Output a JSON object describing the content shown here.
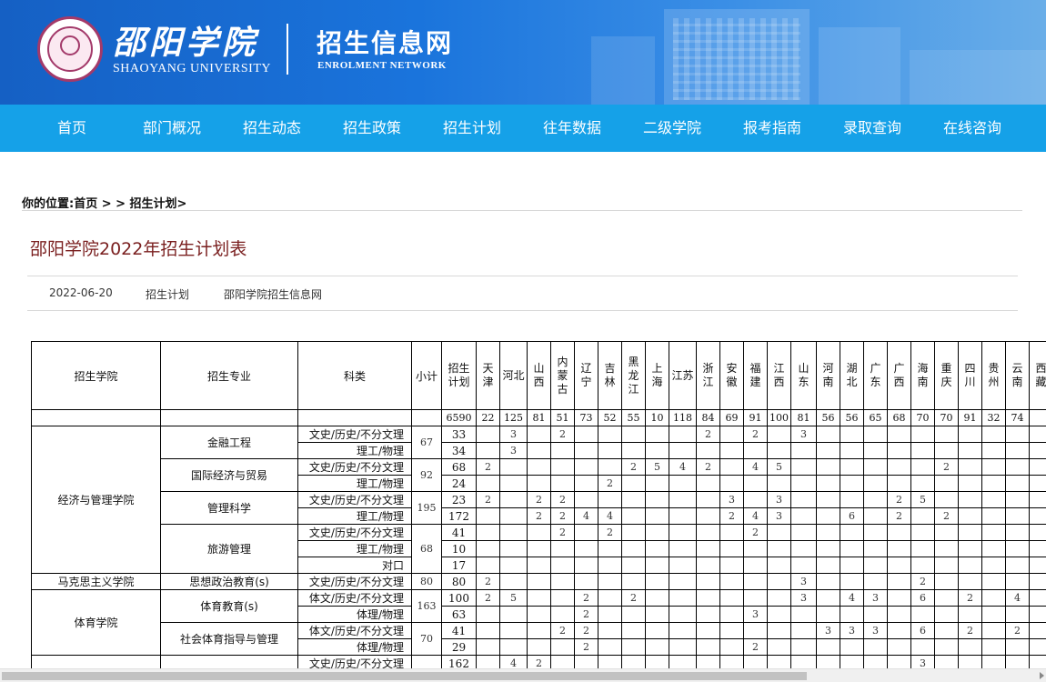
{
  "header": {
    "cn_name": "邵阳学院",
    "en_name": "SHAOYANG UNIVERSITY",
    "site_name": "招生信息网",
    "site_en": "ENROLMENT NETWORK"
  },
  "nav": [
    "首页",
    "部门概况",
    "招生动态",
    "招生政策",
    "招生计划",
    "往年数据",
    "二级学院",
    "报考指南",
    "录取查询",
    "在线咨询"
  ],
  "breadcrumb": "你的位置:首页 > > 招生计划>",
  "article": {
    "title": "邵阳学院2022年招生计划表",
    "date": "2022-06-20",
    "category": "招生计划",
    "source": "邵阳学院招生信息网"
  },
  "table": {
    "headers": {
      "college": "招生学院",
      "major": "招生专业",
      "type": "科类",
      "subtotal": "小计",
      "plan": "招生计划"
    },
    "provinces": [
      "天津",
      "河北",
      "山西",
      "内蒙古",
      "辽宁",
      "吉林",
      "黑龙江",
      "上海",
      "江苏",
      "浙江",
      "安徽",
      "福建",
      "江西",
      "山东",
      "河南",
      "湖北",
      "广东",
      "广西",
      "海南",
      "重庆",
      "四川",
      "贵州",
      "云南",
      "西藏"
    ],
    "totals": {
      "plan": "6590",
      "values": [
        "22",
        "125",
        "81",
        "51",
        "73",
        "52",
        "55",
        "10",
        "118",
        "84",
        "69",
        "91",
        "100",
        "81",
        "56",
        "56",
        "65",
        "68",
        "70",
        "70",
        "91",
        "32",
        "74",
        ""
      ]
    },
    "colleges": [
      {
        "name": "经济与管理学院",
        "majors": [
          {
            "name": "金融工程",
            "subtotal": "67",
            "rows": [
              {
                "type": "文史/历史/不分文理",
                "plan": "33",
                "v": [
                  "",
                  "3",
                  "",
                  "2",
                  "",
                  "",
                  "",
                  "",
                  "",
                  "2",
                  "",
                  "2",
                  "",
                  "3",
                  "",
                  "",
                  "",
                  "",
                  "",
                  "",
                  "",
                  "",
                  "",
                  ""
                ]
              },
              {
                "type": "理工/物理",
                "plan": "34",
                "v": [
                  "",
                  "3",
                  "",
                  "",
                  "",
                  "",
                  "",
                  "",
                  "",
                  "",
                  "",
                  "",
                  "",
                  "",
                  "",
                  "",
                  "",
                  "",
                  "",
                  "",
                  "",
                  "",
                  "",
                  ""
                ]
              }
            ]
          },
          {
            "name": "国际经济与贸易",
            "subtotal": "92",
            "rows": [
              {
                "type": "文史/历史/不分文理",
                "plan": "68",
                "v": [
                  "2",
                  "",
                  "",
                  "",
                  "",
                  "",
                  "2",
                  "5",
                  "4",
                  "2",
                  "",
                  "4",
                  "5",
                  "",
                  "",
                  "",
                  "",
                  "",
                  "",
                  "2",
                  "",
                  "",
                  "",
                  ""
                ]
              },
              {
                "type": "理工/物理",
                "plan": "24",
                "v": [
                  "",
                  "",
                  "",
                  "",
                  "",
                  "2",
                  "",
                  "",
                  "",
                  "",
                  "",
                  "",
                  "",
                  "",
                  "",
                  "",
                  "",
                  "",
                  "",
                  "",
                  "",
                  "",
                  "",
                  ""
                ]
              }
            ]
          },
          {
            "name": "管理科学",
            "subtotal": "195",
            "rows": [
              {
                "type": "文史/历史/不分文理",
                "plan": "23",
                "v": [
                  "2",
                  "",
                  "2",
                  "2",
                  "",
                  "",
                  "",
                  "",
                  "",
                  "",
                  "3",
                  "",
                  "3",
                  "",
                  "",
                  "",
                  "",
                  "2",
                  "5",
                  "",
                  "",
                  "",
                  "",
                  ""
                ]
              },
              {
                "type": "理工/物理",
                "plan": "172",
                "v": [
                  "",
                  "",
                  "2",
                  "2",
                  "4",
                  "4",
                  "",
                  "",
                  "",
                  "",
                  "2",
                  "4",
                  "3",
                  "",
                  "",
                  "6",
                  "",
                  "2",
                  "",
                  "2",
                  "",
                  "",
                  "",
                  ""
                ]
              }
            ]
          },
          {
            "name": "旅游管理",
            "subtotal": "68",
            "rows": [
              {
                "type": "文史/历史/不分文理",
                "plan": "41",
                "v": [
                  "",
                  "",
                  "",
                  "2",
                  "",
                  "2",
                  "",
                  "",
                  "",
                  "",
                  "",
                  "2",
                  "",
                  "",
                  "",
                  "",
                  "",
                  "",
                  "",
                  "",
                  "",
                  "",
                  "",
                  ""
                ]
              },
              {
                "type": "理工/物理",
                "plan": "10",
                "v": [
                  "",
                  "",
                  "",
                  "",
                  "",
                  "",
                  "",
                  "",
                  "",
                  "",
                  "",
                  "",
                  "",
                  "",
                  "",
                  "",
                  "",
                  "",
                  "",
                  "",
                  "",
                  "",
                  "",
                  ""
                ]
              },
              {
                "type": "对口",
                "plan": "17",
                "v": [
                  "",
                  "",
                  "",
                  "",
                  "",
                  "",
                  "",
                  "",
                  "",
                  "",
                  "",
                  "",
                  "",
                  "",
                  "",
                  "",
                  "",
                  "",
                  "",
                  "",
                  "",
                  "",
                  "",
                  ""
                ]
              }
            ]
          }
        ]
      },
      {
        "name": "马克思主义学院",
        "majors": [
          {
            "name": "思想政治教育(s)",
            "subtotal": "80",
            "rows": [
              {
                "type": "文史/历史/不分文理",
                "plan": "80",
                "v": [
                  "2",
                  "",
                  "",
                  "",
                  "",
                  "",
                  "",
                  "",
                  "",
                  "",
                  "",
                  "",
                  "",
                  "3",
                  "",
                  "",
                  "",
                  "",
                  "2",
                  "",
                  "",
                  "",
                  "",
                  ""
                ]
              }
            ]
          }
        ]
      },
      {
        "name": "体育学院",
        "majors": [
          {
            "name": "体育教育(s)",
            "subtotal": "163",
            "rows": [
              {
                "type": "体文/历史/不分文理",
                "plan": "100",
                "v": [
                  "2",
                  "5",
                  "",
                  "",
                  "2",
                  "",
                  "2",
                  "",
                  "",
                  "",
                  "",
                  "",
                  "",
                  "3",
                  "",
                  "4",
                  "3",
                  "",
                  "6",
                  "",
                  "2",
                  "",
                  "4",
                  ""
                ]
              },
              {
                "type": "体理/物理",
                "plan": "63",
                "v": [
                  "",
                  "",
                  "",
                  "",
                  "2",
                  "",
                  "",
                  "",
                  "",
                  "",
                  "",
                  "3",
                  "",
                  "",
                  "",
                  "",
                  "",
                  "",
                  "",
                  "",
                  "",
                  "",
                  "",
                  ""
                ]
              }
            ]
          },
          {
            "name": "社会体育指导与管理",
            "subtotal": "70",
            "rows": [
              {
                "type": "体文/历史/不分文理",
                "plan": "41",
                "v": [
                  "",
                  "",
                  "",
                  "2",
                  "2",
                  "",
                  "",
                  "",
                  "",
                  "",
                  "",
                  "",
                  "",
                  "",
                  "3",
                  "3",
                  "3",
                  "",
                  "6",
                  "",
                  "2",
                  "",
                  "2",
                  ""
                ]
              },
              {
                "type": "体理/物理",
                "plan": "29",
                "v": [
                  "",
                  "",
                  "",
                  "",
                  "2",
                  "",
                  "",
                  "",
                  "",
                  "",
                  "",
                  "2",
                  "",
                  "",
                  "",
                  "",
                  "",
                  "",
                  "",
                  "",
                  "",
                  "",
                  "",
                  ""
                ]
              }
            ]
          }
        ]
      },
      {
        "name": "",
        "majors": [
          {
            "name": "",
            "subtotal": "",
            "rows": [
              {
                "type": "文史/历史/不分文理",
                "plan": "162",
                "v": [
                  "",
                  "4",
                  "2",
                  "",
                  "",
                  "",
                  "",
                  "",
                  "",
                  "",
                  "",
                  "",
                  "",
                  "",
                  "",
                  "",
                  "",
                  "",
                  "3",
                  "",
                  "",
                  "",
                  "",
                  ""
                ]
              }
            ]
          }
        ]
      }
    ]
  }
}
